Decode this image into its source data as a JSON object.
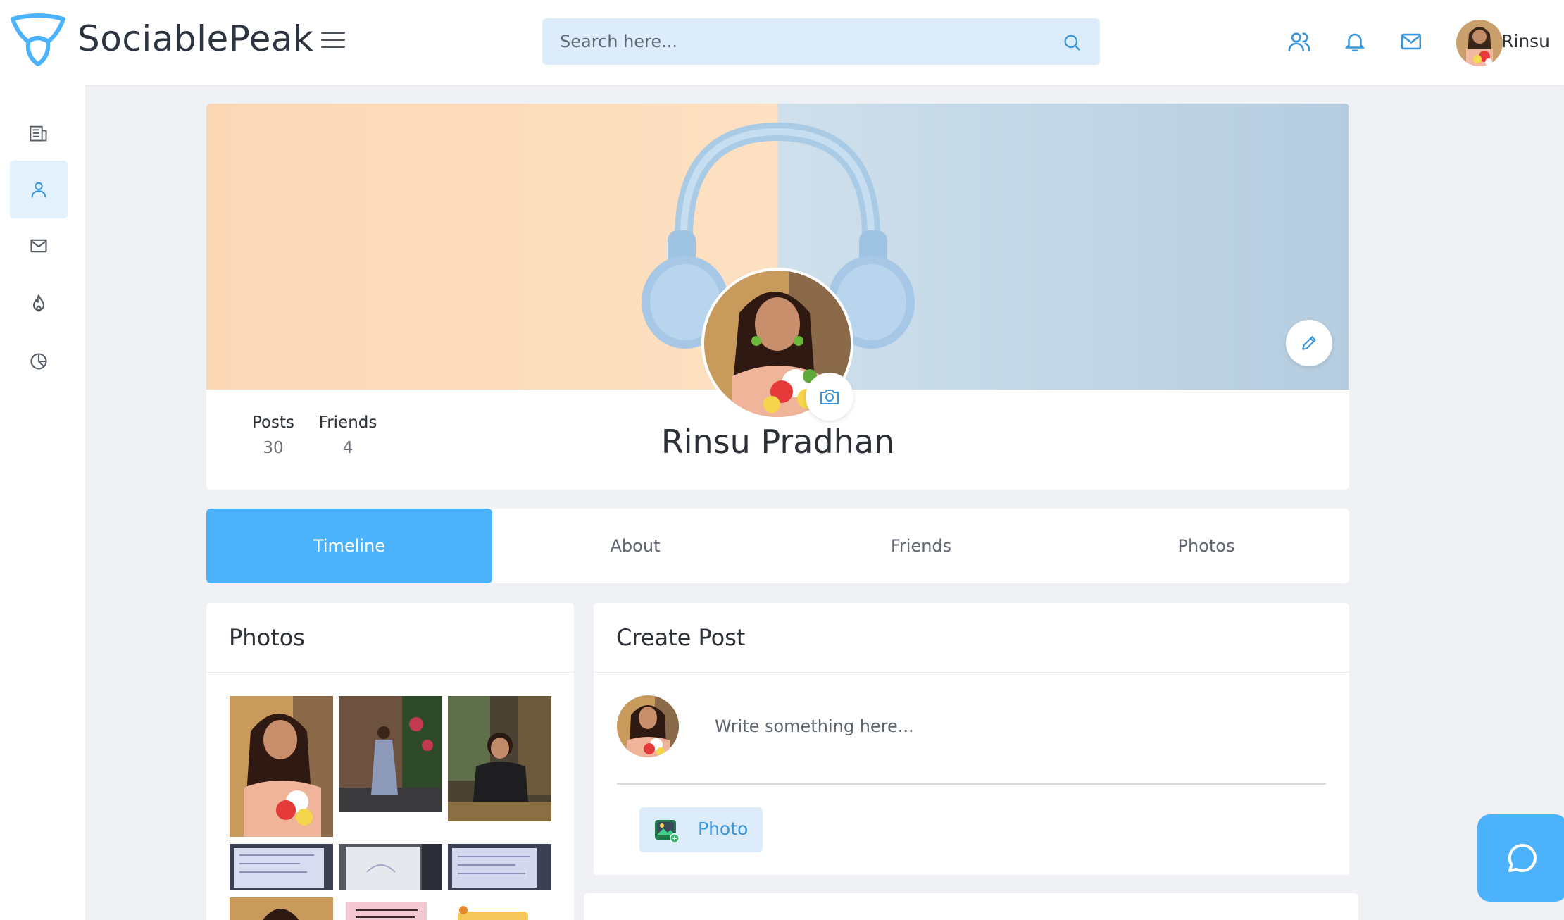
{
  "app": {
    "brand": "SociablePeak",
    "search_placeholder": "Search here...",
    "user_name": "Rinsu"
  },
  "sidebar": {
    "items": [
      {
        "icon": "news-icon",
        "active": false
      },
      {
        "icon": "profile-icon",
        "active": true
      },
      {
        "icon": "mail-icon",
        "active": false
      },
      {
        "icon": "fire-icon",
        "active": false
      },
      {
        "icon": "chart-icon",
        "active": false
      }
    ]
  },
  "header_icons": [
    "friends-icon",
    "bell-icon",
    "mail-icon"
  ],
  "profile": {
    "name": "Rinsu Pradhan",
    "stats": [
      {
        "label": "Posts",
        "value": "30"
      },
      {
        "label": "Friends",
        "value": "4"
      }
    ]
  },
  "tabs": [
    "Timeline",
    "About",
    "Friends",
    "Photos"
  ],
  "active_tab": "Timeline",
  "photos_card": {
    "title": "Photos"
  },
  "create_post": {
    "title": "Create Post",
    "placeholder": "Write something here...",
    "photo_label": "Photo"
  },
  "colors": {
    "accent": "#4db2fc",
    "icon_blue": "#3a95da",
    "search_bg": "#dcecfb",
    "page_bg": "#f0f1f4"
  }
}
